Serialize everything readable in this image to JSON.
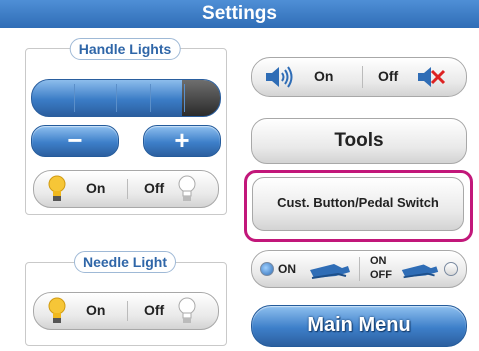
{
  "header": {
    "title": "Settings"
  },
  "handle_lights": {
    "title": "Handle Lights",
    "brightness_level": 0.8,
    "minus_label": "−",
    "plus_label": "+",
    "on_label": "On",
    "off_label": "Off"
  },
  "needle_light": {
    "title": "Needle Light",
    "on_label": "On",
    "off_label": "Off"
  },
  "sound": {
    "on_label": "On",
    "off_label": "Off"
  },
  "tools": {
    "label": "Tools"
  },
  "custom_button": {
    "label": "Cust. Button/Pedal Switch"
  },
  "switch_mode": {
    "on_label": "ON",
    "on_off_line1": "ON",
    "on_off_line2": "OFF"
  },
  "main_menu": {
    "label": "Main Menu"
  },
  "colors": {
    "accent_blue": "#2f6db6",
    "highlight_magenta": "#c2177a"
  }
}
